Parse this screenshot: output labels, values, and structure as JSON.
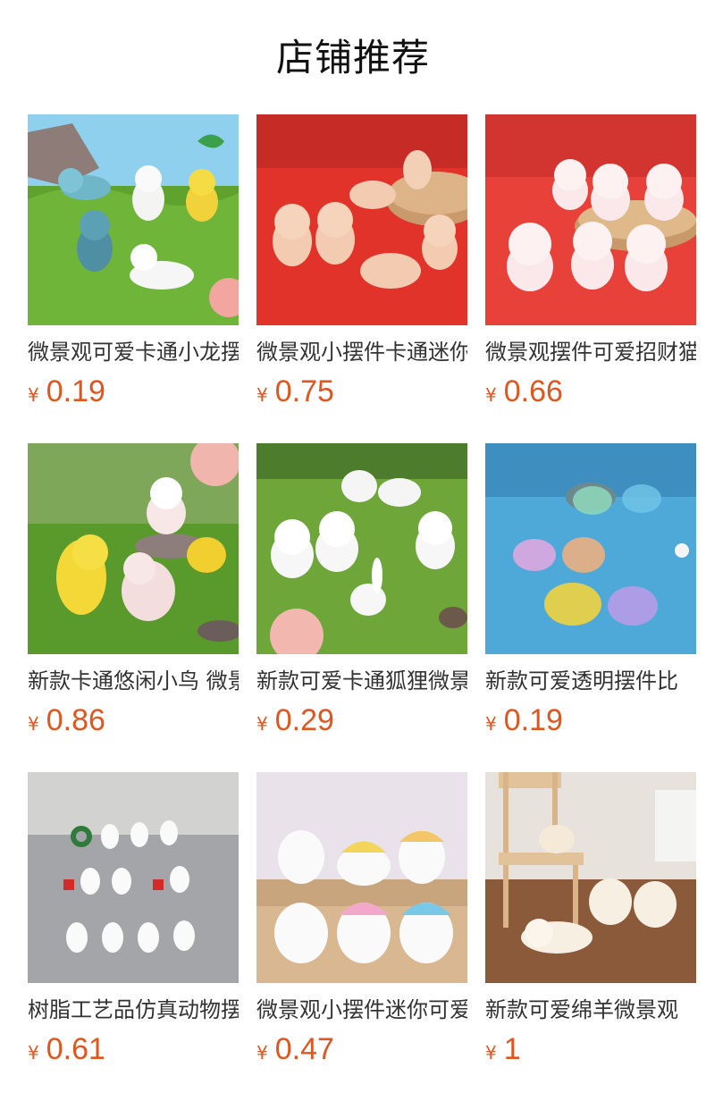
{
  "page_title": "店铺推荐",
  "currency_symbol": "¥",
  "products": [
    {
      "name": "微景观可爱卡通小龙摆件",
      "price": "0.19",
      "theme": "dragons-on-grass",
      "bg": "#7fb43a"
    },
    {
      "name": "微景观小摆件卡通迷你",
      "price": "0.75",
      "theme": "dragons-on-red",
      "bg": "#e2332b"
    },
    {
      "name": "微景观摆件可爱招财猫",
      "price": "0.66",
      "theme": "lucky-cats-on-red",
      "bg": "#e8413a"
    },
    {
      "name": "新款卡通悠闲小鸟 微景观",
      "price": "0.86",
      "theme": "birds-on-grass",
      "bg": "#5a9a2c"
    },
    {
      "name": "新款可爱卡通狐狸微景观",
      "price": "0.29",
      "theme": "foxes-on-grass",
      "bg": "#6ea63a"
    },
    {
      "name": "新款可爱透明摆件比",
      "price": "0.19",
      "theme": "crystal-fish-on-blue",
      "bg": "#4fa9d8"
    },
    {
      "name": "树脂工艺品仿真动物摆件",
      "price": "0.61",
      "theme": "rabbits-on-gray",
      "bg": "#a3a5a8"
    },
    {
      "name": "微景观小摆件迷你可爱",
      "price": "0.47",
      "theme": "puppies-on-wood",
      "bg": "#c9a57e"
    },
    {
      "name": "新款可爱绵羊微景观",
      "price": "1",
      "theme": "sheep-on-wood",
      "bg": "#8a5a3b"
    }
  ]
}
